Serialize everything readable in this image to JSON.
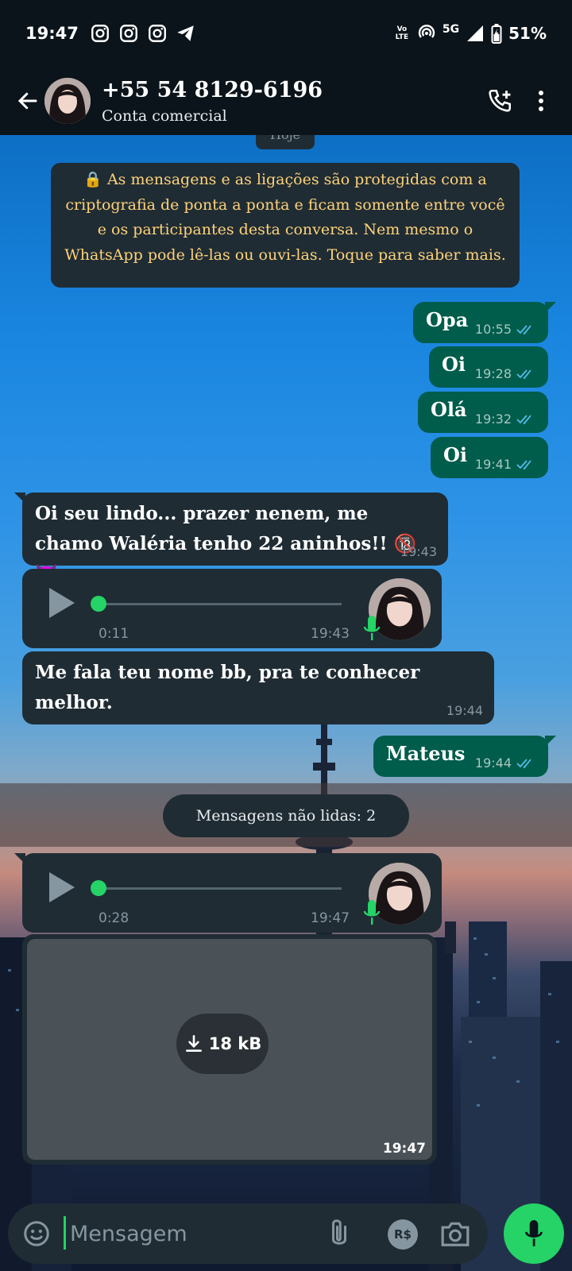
{
  "status_bar": {
    "time": "19:47",
    "network": "5G",
    "volte": "Vo LTE",
    "battery": "51%"
  },
  "header": {
    "contact_name": "+55 54 8129-6196",
    "subtitle": "Conta comercial"
  },
  "chat": {
    "day_chip": "Hoje",
    "e2e_notice": "🔒 As mensagens e as ligações são protegidas com a criptografia de ponta a ponta e ficam somente entre você e os participantes desta conversa. Nem mesmo o WhatsApp pode lê-las ou ouvi-las. Toque para saber mais.",
    "messages": [
      {
        "text": "Opa",
        "time": "10:55"
      },
      {
        "text": "Oi",
        "time": "19:28"
      },
      {
        "text": "Olá",
        "time": "19:32"
      },
      {
        "text": "Oi",
        "time": "19:41"
      },
      {
        "text": "Oi seu lindo... prazer nenem, me chamo Waléria tenho 22 aninhos!! 🔞😈",
        "time": "19:43"
      },
      {
        "duration": "0:11",
        "time": "19:43"
      },
      {
        "text": "Me fala teu nome bb, pra te conhecer melhor.",
        "time": "19:44"
      },
      {
        "text": "Mateus",
        "time": "19:44"
      },
      {
        "duration": "0:28",
        "time": "19:47"
      },
      {
        "size": "18 kB",
        "time": "19:47"
      }
    ],
    "unread_label": "Mensagens não lidas: 2"
  },
  "input": {
    "placeholder": "Mensagem",
    "pay_label": "R$"
  },
  "colors": {
    "outgoing_bubble": "#005c4b",
    "incoming_bubble": "#1f2c34",
    "accent_green": "#25d366",
    "read_ticks": "#53bdeb",
    "e2e_text": "#ffd279"
  }
}
